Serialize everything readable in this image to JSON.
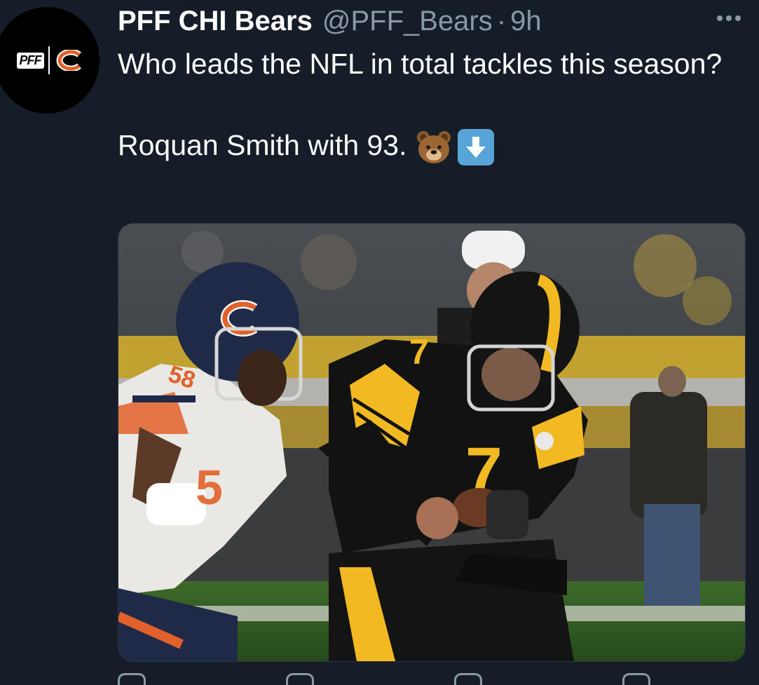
{
  "tweet": {
    "display_name": "PFF CHI Bears",
    "handle": "@PFF_Bears",
    "separator": "·",
    "time": "9h",
    "text_line1": "Who leads the NFL in total tackles this season?",
    "text_line2": "Roquan Smith with 93.",
    "emojis": [
      "bear-face-emoji",
      "down-arrow-emoji"
    ],
    "avatar_logo_text": "PFF"
  },
  "photo": {
    "bears_number": "58",
    "steelers_number": "7",
    "colors": {
      "bears_navy": "#1e2a47",
      "bears_orange": "#e2612a",
      "steelers_black": "#121212",
      "steelers_gold": "#f2b922"
    }
  },
  "colors": {
    "background": "#151d28",
    "muted_text": "#8b98a5",
    "text": "#ffffff"
  },
  "actions": [
    "reply-icon",
    "retweet-icon",
    "like-icon",
    "share-icon"
  ]
}
